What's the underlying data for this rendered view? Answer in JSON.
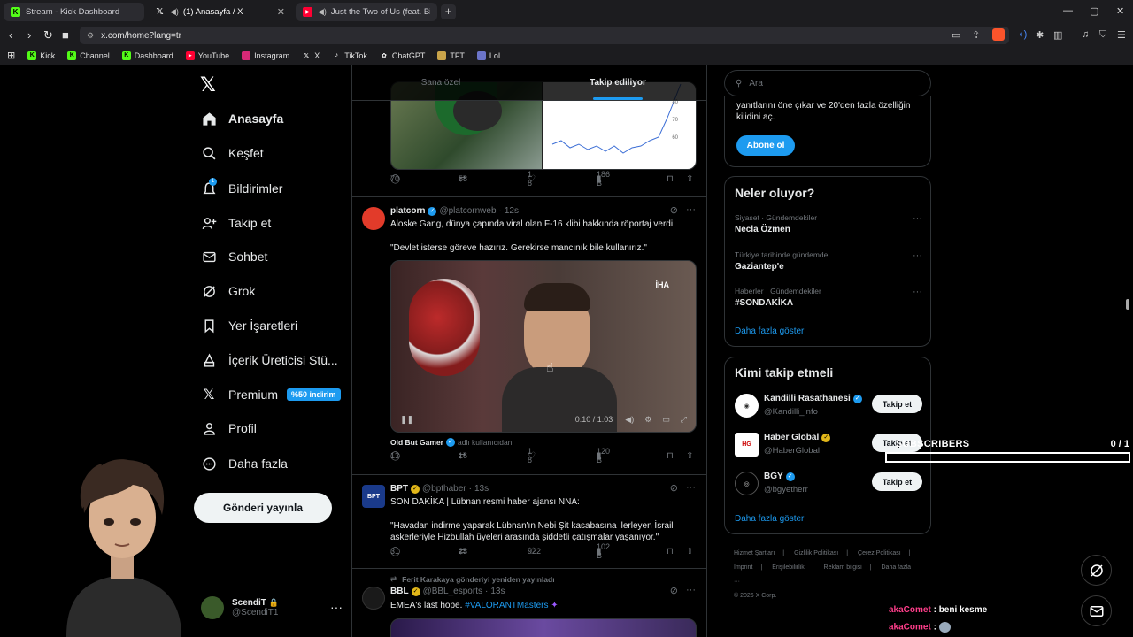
{
  "browser": {
    "tabs": [
      {
        "title": "Stream - Kick Dashboard",
        "icon": "kick-icon",
        "active": false
      },
      {
        "title": "(1) Anasayfa / X",
        "icon": "x-icon",
        "active": true
      },
      {
        "title": "Just the Two of Us (feat. Bill Withers",
        "icon": "youtube-icon",
        "active": false
      }
    ],
    "url": "x.com/home?lang=tr",
    "bookmarks": [
      "Kick",
      "Channel",
      "Dashboard",
      "YouTube",
      "Instagram",
      "X",
      "TikTok",
      "ChatGPT",
      "TFT",
      "LoL"
    ]
  },
  "nav": {
    "items": [
      "Anasayfa",
      "Keşfet",
      "Bildirimler",
      "Takip et",
      "Sohbet",
      "Grok",
      "Yer İşaretleri",
      "İçerik Üreticisi Stü...",
      "Premium",
      "Profil",
      "Daha fazla"
    ],
    "notification_count": "1",
    "premium_badge": "%50 indirim",
    "post_button": "Gönderi yayınla",
    "profile_name": "ScendiT",
    "profile_handle": "@ScendiT1"
  },
  "feed": {
    "tabs": [
      "Sana özel",
      "Takip ediliyor"
    ],
    "posts": [
      {
        "replies": "70",
        "reposts": "58",
        "likes": "1 8",
        "views": "186 B",
        "chart_ticks": [
          "80",
          "70",
          "60"
        ]
      },
      {
        "name": "platcorn",
        "handle": "@platcornweb",
        "time": "12s",
        "text": "Aloske Gang, dünya çapında viral olan F-16 klibi hakkında röportaj verdi.",
        "quote": "\"Devlet isterse göreve hazırız. Gerekirse mancınık bile kullanırız.\"",
        "video_watermark": "İHA",
        "video_time": "0:10 / 1:03",
        "credit_name": "Old But Gamer",
        "credit_note": "adlı kullanıcıdan",
        "replies": "13",
        "reposts": "16",
        "likes": "1 8",
        "views": "120 B"
      },
      {
        "name": "BPT",
        "handle": "@bpthaber",
        "time": "13s",
        "text": "SON DAKİKA | Lübnan resmi haber ajansı NNA:",
        "quote": "\"Havadan indirme yaparak Lübnan'ın Nebi Şit kasabasına ilerleyen İsrail askerleriyle Hizbullah üyeleri arasında şiddetli çatışmalar yaşanıyor.\"",
        "replies": "31",
        "reposts": "23",
        "likes": "922",
        "views": "102 B"
      },
      {
        "reposted_by": "Ferit Karakaya gönderiyi yeniden yayınladı",
        "name": "BBL",
        "handle": "@BBL_esports",
        "time": "13s",
        "text": "EMEA's last hope.",
        "hashtag": "#VALORANTMasters"
      }
    ]
  },
  "sidebar": {
    "search_placeholder": "Ara",
    "premium_text": "yanıtlarını öne çıkar ve 20'den fazla özelliğin kilidini aç.",
    "subscribe": "Abone ol",
    "trends_title": "Neler oluyor?",
    "trends": [
      {
        "category": "Siyaset · Gündemdekiler",
        "name": "Necla Özmen"
      },
      {
        "category": "Türkiye tarihinde gündemde",
        "name": "Gaziantep'e"
      },
      {
        "category": "Haberler · Gündemdekiler",
        "name": "#SONDAKİKA"
      }
    ],
    "show_more": "Daha fazla göster",
    "who_title": "Kimi takip etmeli",
    "who": [
      {
        "name": "Kandilli Rasathanesi",
        "handle": "@Kandilli_info",
        "button": "Takip et",
        "badge": "blue"
      },
      {
        "name": "Haber Global",
        "handle": "@HaberGlobal",
        "button": "Takip et",
        "badge": "gold"
      },
      {
        "name": "BGY",
        "handle": "@bgyetherr",
        "button": "Takip et",
        "badge": "blue"
      }
    ],
    "footer": [
      "Hizmet Şartları",
      "|",
      "Gizlilik Politikası",
      "|",
      "Çerez Politikası",
      "|",
      "Imprint",
      "|",
      "Erişilebilirlik",
      "|",
      "Reklam bilgisi",
      "|",
      "Daha fazla ···",
      "© 2026 X Corp."
    ]
  },
  "overlay": {
    "subs_label": "SUBSCRIBERS",
    "subs_count": "0 / 1",
    "subs_progress": 0,
    "chat": [
      {
        "user": "akaComet",
        "message": "beni kesme"
      },
      {
        "user": "akaComet",
        "message": ""
      }
    ]
  }
}
